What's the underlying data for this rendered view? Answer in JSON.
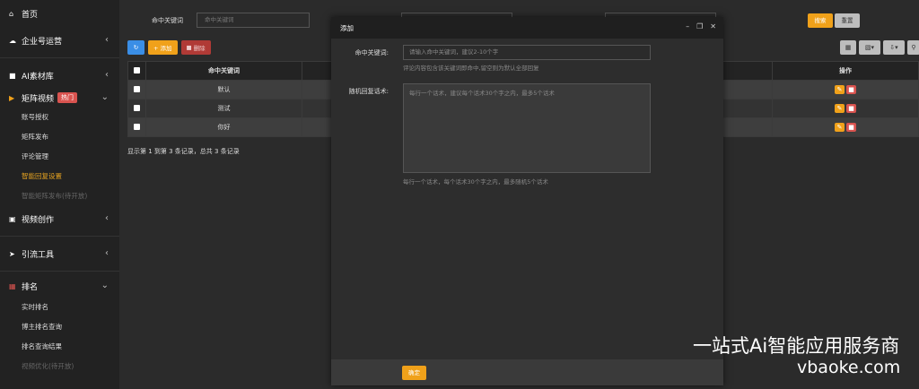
{
  "sidebar": {
    "home": "首页",
    "enterprise": "企业号运营",
    "ai_materials": "AI素材库",
    "matrix_video": "矩阵视频",
    "hot_badge": "热门",
    "matrix_sub": [
      "账号授权",
      "矩阵发布",
      "评论管理",
      "智能回复设置",
      "智能矩阵发布(待开放)"
    ],
    "video_create": "视频创作",
    "traffic_tools": "引流工具",
    "ranking": "排名",
    "ranking_sub": [
      "实时排名",
      "博主排名查询",
      "排名查询结果",
      "视频优化(待开放)"
    ]
  },
  "search": {
    "label": "命中关键词",
    "placeholder": "命中关键词",
    "search_btn": "搜索",
    "reset_btn": "重置"
  },
  "toolbar": {
    "add": "+ 添加",
    "delete": "删除"
  },
  "table": {
    "col_keyword": "命中关键词",
    "col_action": "操作",
    "rows": [
      "默认",
      "测试",
      "你好"
    ],
    "pager": "显示第 1 到第 3 条记录，总共 3 条记录"
  },
  "modal": {
    "title": "添加",
    "keyword_label": "命中关键词:",
    "keyword_placeholder": "请输入命中关键词，建议2-10个字",
    "keyword_help": "评论内容包含该关键词即命中,留空则为默认全部回复",
    "reply_label": "随机回复话术:",
    "reply_placeholder": "每行一个话术，建议每个话术30个字之内，最多5个话术",
    "reply_help": "每行一个话术，每个话术30个字之内，最多随机5个话术",
    "ok": "确定"
  },
  "watermark": {
    "line1": "一站式Ai智能应用服务商",
    "line2": "vbaoke.com"
  },
  "icons": {
    "home": "home-icon",
    "cloud": "cloud-icon",
    "folder": "folder-icon",
    "video": "video-icon",
    "film": "film-icon",
    "send": "send-icon",
    "chart": "chart-icon"
  },
  "colors": {
    "accent": "#f0a11a",
    "danger": "#d9534f",
    "primary": "#3a8ee6"
  }
}
